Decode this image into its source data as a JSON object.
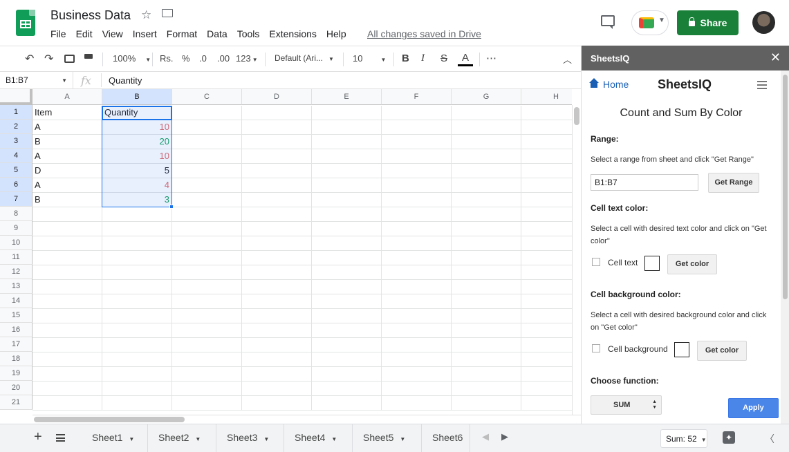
{
  "app": {
    "doc_title": "Business Data",
    "menu": [
      "File",
      "Edit",
      "View",
      "Insert",
      "Format",
      "Data",
      "Tools",
      "Extensions",
      "Help"
    ],
    "saved_status": "All changes saved in Drive",
    "share_label": "Share"
  },
  "toolbar": {
    "zoom": "100%",
    "currency": "Rs.",
    "percent": "%",
    "dec_decrease": ".0",
    "dec_increase": ".00",
    "more_formats": "123",
    "font": "Default (Ari...",
    "font_size": "10",
    "bold": "B",
    "italic": "I",
    "strike": "S",
    "text_color": "A",
    "more": "⋯"
  },
  "formula_bar": {
    "name_box": "B1:B7",
    "fx": "fx",
    "value": "Quantity"
  },
  "grid": {
    "columns": [
      "A",
      "B",
      "C",
      "D",
      "E",
      "F",
      "G",
      "H"
    ],
    "row_numbers": [
      "1",
      "2",
      "3",
      "4",
      "5",
      "6",
      "7",
      "8",
      "9",
      "10",
      "11",
      "12",
      "13",
      "14",
      "15",
      "16",
      "17",
      "18",
      "19",
      "20",
      "21"
    ],
    "cells": [
      {
        "item": "Item",
        "qty": "Quantity",
        "color": "#202124",
        "header": true
      },
      {
        "item": "A",
        "qty": "10",
        "color": "#e06666"
      },
      {
        "item": "B",
        "qty": "20",
        "color": "#0f9d58"
      },
      {
        "item": "A",
        "qty": "10",
        "color": "#e06666"
      },
      {
        "item": "D",
        "qty": "5",
        "color": "#202124"
      },
      {
        "item": "A",
        "qty": "4",
        "color": "#e06666"
      },
      {
        "item": "B",
        "qty": "3",
        "color": "#0f9d58"
      }
    ]
  },
  "sheets": [
    "Sheet1",
    "Sheet2",
    "Sheet3",
    "Sheet4",
    "Sheet5",
    "Sheet6"
  ],
  "status": {
    "sum": "Sum: 52"
  },
  "panel": {
    "title": "SheetsIQ",
    "home": "Home",
    "brand": "SheetsIQ",
    "heading": "Count and Sum By Color",
    "range_label": "Range:",
    "range_desc": "Select a range from sheet and click \"Get Range\"",
    "range_value": "B1:B7",
    "get_range": "Get Range",
    "text_color_label": "Cell text color:",
    "text_color_desc": "Select a cell with desired text color and click on \"Get color\"",
    "cell_text": "Cell text",
    "get_color": "Get color",
    "bg_color_label": "Cell background color:",
    "bg_color_desc": "Select a cell with desired background color and click on \"Get color\"",
    "cell_background": "Cell background",
    "function_label": "Choose function:",
    "function_value": "SUM",
    "apply": "Apply"
  }
}
